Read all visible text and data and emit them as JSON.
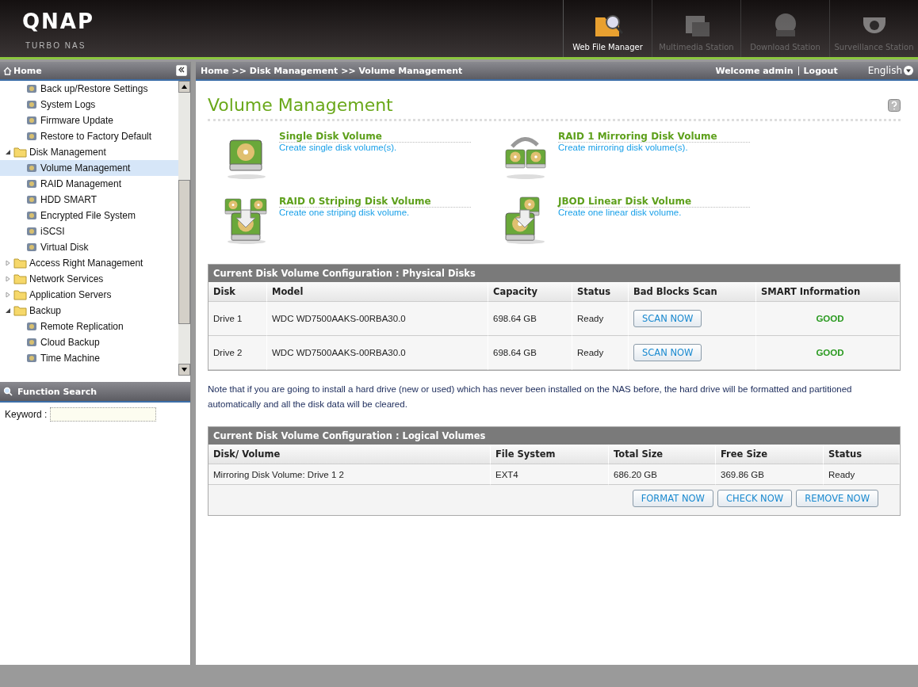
{
  "header": {
    "logo": "QNAP",
    "subtitle": "TURBO NAS",
    "apps": [
      {
        "label": "Web File Manager",
        "kind": "files",
        "selected": true
      },
      {
        "label": "Multimedia Station",
        "kind": "media",
        "selected": false
      },
      {
        "label": "Download Station",
        "kind": "download",
        "selected": false
      },
      {
        "label": "Surveillance Station",
        "kind": "camera",
        "selected": false
      }
    ]
  },
  "sidebar": {
    "home": "Home",
    "tree": [
      {
        "label": "Back up/Restore Settings",
        "kind": "item"
      },
      {
        "label": "System Logs",
        "kind": "item"
      },
      {
        "label": "Firmware Update",
        "kind": "item"
      },
      {
        "label": "Restore to Factory Default",
        "kind": "item"
      },
      {
        "label": "Disk Management",
        "kind": "folder",
        "expanded": true,
        "children": [
          {
            "label": "Volume Management",
            "kind": "item",
            "selected": true
          },
          {
            "label": "RAID Management",
            "kind": "item",
            "selected": false
          },
          {
            "label": "HDD SMART",
            "kind": "item",
            "selected": false
          },
          {
            "label": "Encrypted File System",
            "kind": "item",
            "selected": false
          },
          {
            "label": "iSCSI",
            "kind": "item",
            "selected": false
          },
          {
            "label": "Virtual Disk",
            "kind": "item",
            "selected": false
          }
        ]
      },
      {
        "label": "Access Right Management",
        "kind": "folder",
        "expanded": false
      },
      {
        "label": "Network Services",
        "kind": "folder",
        "expanded": false
      },
      {
        "label": "Application Servers",
        "kind": "folder",
        "expanded": false
      },
      {
        "label": "Backup",
        "kind": "folder",
        "expanded": true,
        "children": [
          {
            "label": "Remote Replication",
            "kind": "item",
            "selected": false
          },
          {
            "label": "Cloud Backup",
            "kind": "item",
            "selected": false
          },
          {
            "label": "Time Machine",
            "kind": "item",
            "selected": false
          }
        ]
      }
    ],
    "search": {
      "title": "Function Search",
      "label": "Keyword :"
    }
  },
  "topbar": {
    "breadcrumb": "Home >> Disk Management >> Volume Management",
    "welcome": "Welcome admin",
    "logout": "Logout",
    "language": "English"
  },
  "main": {
    "title": "Volume Management",
    "options": [
      {
        "title": "Single Disk Volume",
        "description": "Create single disk volume(s).",
        "kind": "single"
      },
      {
        "title": "RAID 1 Mirroring Disk Volume",
        "description": "Create mirroring disk volume(s).",
        "kind": "mirror"
      },
      {
        "title": "RAID 0 Striping Disk Volume",
        "description": "Create one striping disk volume.",
        "kind": "stripe"
      },
      {
        "title": "JBOD Linear Disk Volume",
        "description": "Create one linear disk volume.",
        "kind": "linear"
      }
    ],
    "physical": {
      "title": "Current Disk Volume Configuration : Physical Disks",
      "columns": [
        "Disk",
        "Model",
        "Capacity",
        "Status",
        "Bad Blocks Scan",
        "SMART Information"
      ],
      "rows": [
        {
          "disk": "Drive 1",
          "model": "WDC WD7500AAKS-00RBA30.0",
          "capacity": "698.64 GB",
          "status": "Ready",
          "scan": "SCAN NOW",
          "smart": "GOOD"
        },
        {
          "disk": "Drive 2",
          "model": "WDC WD7500AAKS-00RBA30.0",
          "capacity": "698.64 GB",
          "status": "Ready",
          "scan": "SCAN NOW",
          "smart": "GOOD"
        }
      ]
    },
    "note": "Note that if you are going to install a hard drive (new or used) which has never been installed on the NAS before, the hard drive will be formatted and partitioned automatically and all the disk data will be cleared.",
    "logical": {
      "title": "Current Disk Volume Configuration : Logical Volumes",
      "columns": [
        "Disk/ Volume",
        "File System",
        "Total Size",
        "Free Size",
        "Status"
      ],
      "rows": [
        [
          "Mirroring Disk Volume: Drive 1 2",
          "EXT4",
          "686.20 GB",
          "369.86 GB",
          "Ready"
        ]
      ],
      "buttons": [
        "FORMAT NOW",
        "CHECK NOW",
        "REMOVE NOW"
      ]
    }
  }
}
